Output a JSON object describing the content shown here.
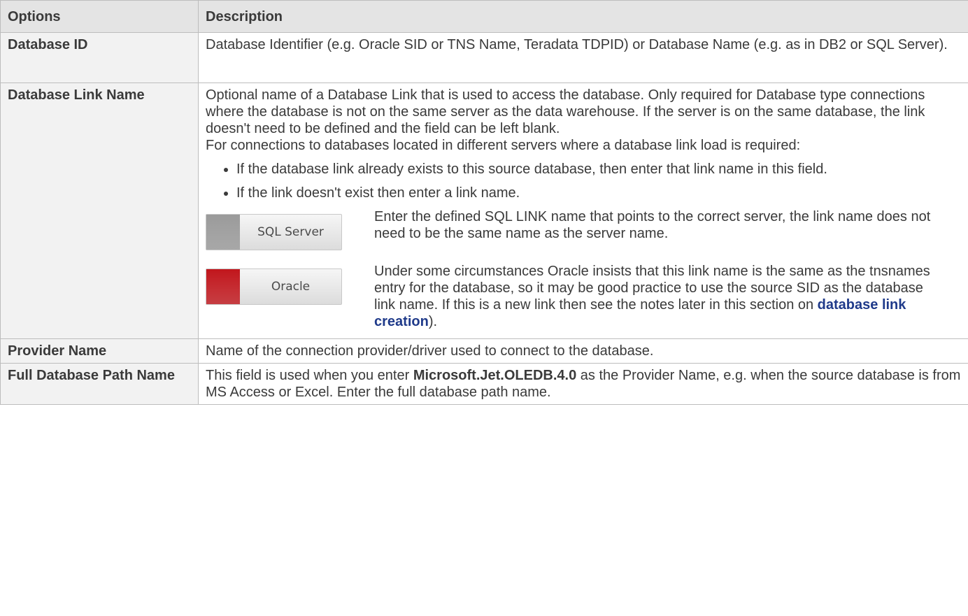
{
  "header": {
    "col1": "Options",
    "col2": "Description"
  },
  "rows": [
    {
      "option": "Database ID",
      "description": "Database Identifier (e.g. Oracle SID or TNS Name, Teradata TDPID) or Database Name (e.g. as in DB2 or SQL Server)."
    },
    {
      "option": "Database Link Name",
      "para1": "Optional name of a Database Link that is used to access the database. Only required for Database type connections where the database is not on the same server as the data warehouse. If the server is on the same database, the link doesn't need to be defined and the field can be left blank.",
      "para2": "For connections to databases located in different servers where a database link load is required:",
      "bullets": [
        "If the database link already exists to this source database, then enter that link name in this field.",
        "If the link doesn't exist then enter a link name."
      ],
      "platforms": [
        {
          "badge": "SQL Server",
          "color": "#9a9a9a",
          "text": " Enter the defined SQL LINK name that points to the correct server, the link name does not need to be the same name as the server name."
        },
        {
          "badge": "Oracle",
          "color": "#c1161c",
          "text": " Under some circumstances Oracle insists that this link name is the same as the tnsnames entry for the database, so it may be good practice to use the source SID as the database link name. If this is a new link then see the notes later in this section on ",
          "link": "database link creation",
          "tail": ")."
        }
      ]
    },
    {
      "option": "Provider Name",
      "description": "Name of the connection provider/driver used to connect to the database."
    },
    {
      "option": "Full Database Path Name",
      "pre": "This field is used when you enter ",
      "bold": "Microsoft.Jet.OLEDB.4.0",
      "post": " as the Provider Name, e.g. when the source database is from MS Access or Excel. Enter the full database path name."
    }
  ]
}
